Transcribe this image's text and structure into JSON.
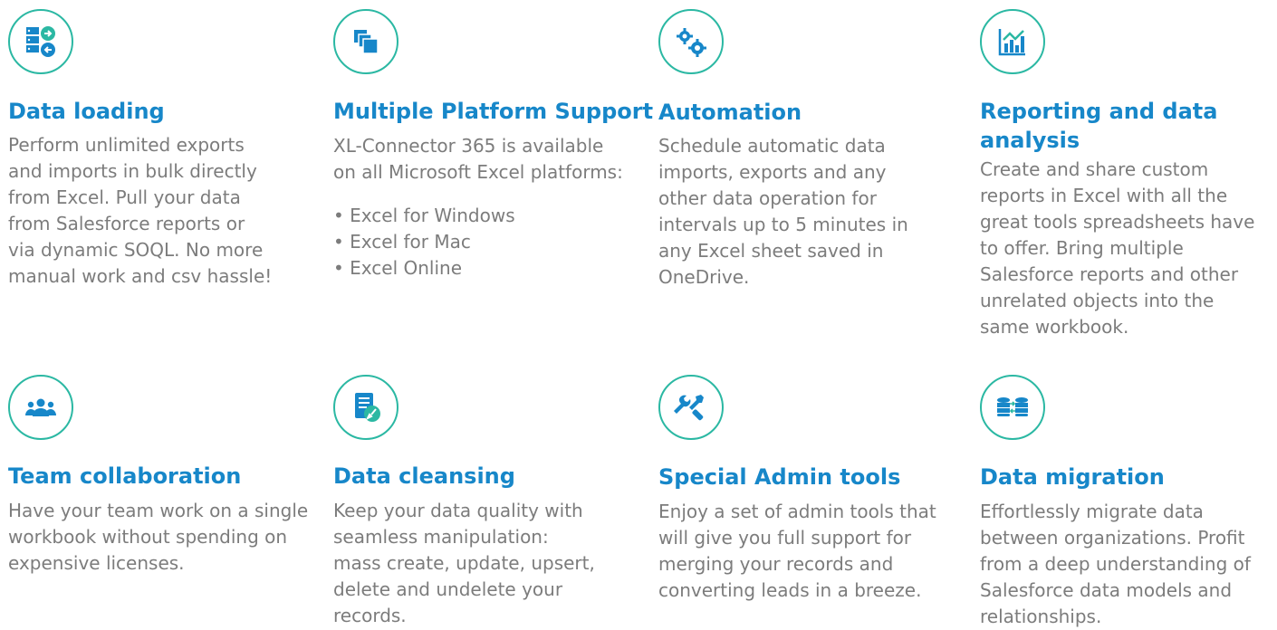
{
  "features": [
    {
      "title": "Data loading",
      "icon": "data-loading-icon",
      "description": "Perform unlimited exports\nand imports in bulk directly\nfrom Excel. Pull your data\nfrom Salesforce reports or\nvia dynamic SOQL. No more\nmanual work and csv hassle!"
    },
    {
      "title": "Multiple Platform Support",
      "icon": "multiple-windows-icon",
      "description": "XL-Connector 365 is available\non all Microsoft Excel platforms:",
      "bullets": [
        "Excel for Windows",
        "Excel for Mac",
        "Excel Online"
      ]
    },
    {
      "title": "Automation",
      "icon": "gears-icon",
      "description": "Schedule automatic data\nimports, exports and any\nother data operation for\nintervals up to 5 minutes in\nany Excel sheet saved in\nOneDrive."
    },
    {
      "title": "Reporting and data\nanalysis",
      "icon": "chart-icon",
      "description": "Create and share custom\nreports in Excel with all the\ngreat tools spreadsheets have\nto offer. Bring multiple\nSalesforce reports and other\nunrelated objects into the\nsame workbook."
    },
    {
      "title": "Team collaboration",
      "icon": "team-icon",
      "description": "Have your team work on a single\nworkbook without spending on\nexpensive licenses."
    },
    {
      "title": "Data cleansing",
      "icon": "document-broom-icon",
      "description": "Keep your data quality with\nseamless manipulation:\nmass create, update, upsert,\ndelete and undelete your\nrecords."
    },
    {
      "title": "Special Admin tools",
      "icon": "tools-icon",
      "description": "Enjoy a set of admin tools that\nwill give you full support for\nmerging your records and\nconverting leads in a breeze."
    },
    {
      "title": "Data migration",
      "icon": "database-transfer-icon",
      "description": "Effortlessly migrate data\nbetween organizations. Profit\nfrom a deep understanding of\nSalesforce data models and\nrelationships."
    }
  ],
  "colors": {
    "accent": "#2bb8a3",
    "title": "#1787c9",
    "text": "#7c7c7c"
  }
}
